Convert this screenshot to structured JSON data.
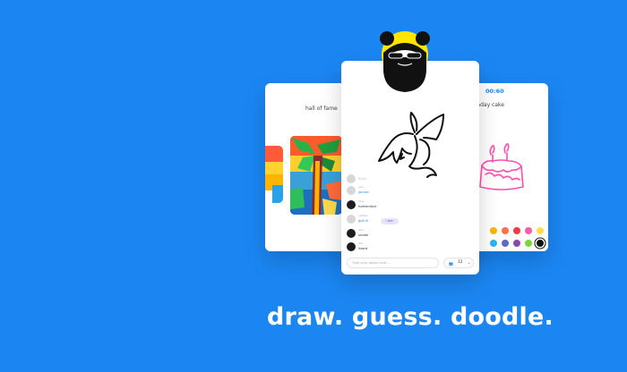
{
  "left_card": {
    "title": "hall of fame"
  },
  "right_card": {
    "timer": "00:60",
    "word": "birthday cake",
    "palette": [
      "#ffb300",
      "#ff7043",
      "#ef3b47",
      "#ff5aa8",
      "#ffe04a",
      "#ffffff",
      "#29b6f6",
      "#5c6bc0",
      "#8e44ad",
      "#e040fb",
      "#7cd63a",
      "#111111"
    ]
  },
  "chat": {
    "messages": [
      {
        "meta": "",
        "name": "flo/is",
        "style": "faded",
        "avatar": "light"
      },
      {
        "meta": "ryan",
        "name": "joined",
        "style": "blue",
        "avatar": "light"
      },
      {
        "meta": "mike",
        "name": "hartendice",
        "style": "normal",
        "avatar": "dark"
      },
      {
        "meta": "cas/fast",
        "name": "got it!",
        "style": "blue",
        "avatar": "light",
        "badge": "i won"
      },
      {
        "meta": "alice",
        "name": "snake",
        "style": "normal",
        "avatar": "dark"
      },
      {
        "meta": "alex",
        "name": "lizard",
        "style": "normal",
        "avatar": "dark"
      }
    ],
    "badge_text": "i won"
  },
  "guess": {
    "placeholder": "Type your guess here..."
  },
  "players": {
    "count": "12"
  },
  "tagline": "draw. guess. doodle."
}
